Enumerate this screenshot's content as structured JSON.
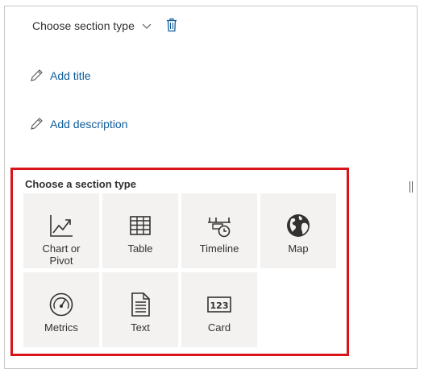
{
  "section_header": {
    "dropdown_label": "Choose section type",
    "dropdown_icon": "chevron-down-icon",
    "delete_icon": "trash-icon"
  },
  "links": {
    "add_title": "Add title",
    "add_description": "Add description",
    "icon": "pencil-icon"
  },
  "picker": {
    "heading": "Choose a section type",
    "border_color": "#d7141a",
    "tiles": [
      {
        "label": "Chart or\nPivot",
        "icon": "chart-icon"
      },
      {
        "label": "Table",
        "icon": "table-icon"
      },
      {
        "label": "Timeline",
        "icon": "timeline-icon"
      },
      {
        "label": "Map",
        "icon": "globe-icon"
      },
      {
        "label": "Metrics",
        "icon": "gauge-icon"
      },
      {
        "label": "Text",
        "icon": "document-icon"
      },
      {
        "label": "Card",
        "icon": "card-icon"
      }
    ]
  },
  "colors": {
    "link": "#0f5c99",
    "tile_bg": "#f3f2f1",
    "text": "#323130"
  }
}
